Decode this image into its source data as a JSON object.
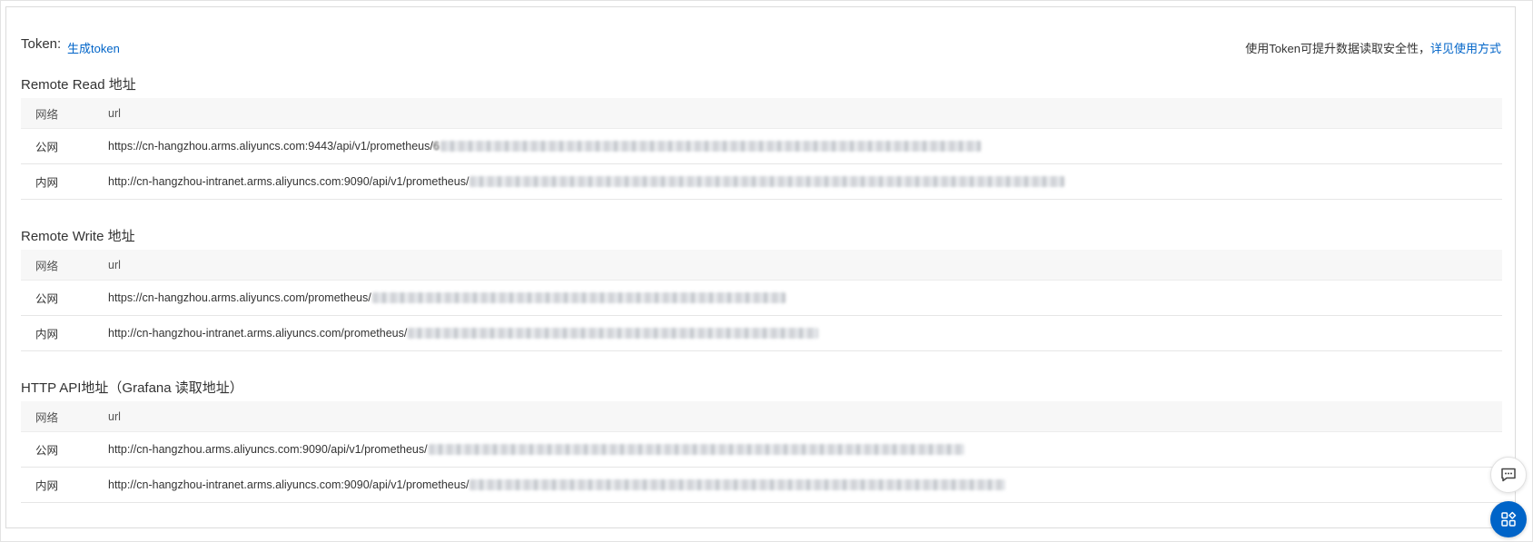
{
  "token": {
    "label": "Token:",
    "generate_link": "生成token",
    "hint_text": "使用Token可提升数据读取安全性，",
    "hint_link": "详见使用方式"
  },
  "headers": {
    "network": "网络",
    "url": "url"
  },
  "sections": [
    {
      "title": "Remote Read 地址",
      "rows": [
        {
          "network": "公网",
          "url": "https://cn-hangzhou.arms.aliyuncs.com:9443/api/v1/prometheus/",
          "redacted_tail": "6"
        },
        {
          "network": "内网",
          "url": "http://cn-hangzhou-intranet.arms.aliyuncs.com:9090/api/v1/prometheus/",
          "redacted_tail": ""
        }
      ]
    },
    {
      "title": "Remote Write 地址",
      "rows": [
        {
          "network": "公网",
          "url": "https://cn-hangzhou.arms.aliyuncs.com/prometheus/",
          "redacted_tail": ""
        },
        {
          "network": "内网",
          "url": "http://cn-hangzhou-intranet.arms.aliyuncs.com/prometheus/",
          "redacted_tail": ""
        }
      ]
    },
    {
      "title": "HTTP API地址（Grafana 读取地址）",
      "rows": [
        {
          "network": "公网",
          "url": "http://cn-hangzhou.arms.aliyuncs.com:9090/api/v1/prometheus/",
          "redacted_tail": ""
        },
        {
          "network": "内网",
          "url": "http://cn-hangzhou-intranet.arms.aliyuncs.com:9090/api/v1/prometheus/",
          "redacted_tail": ""
        }
      ]
    }
  ],
  "floating": {
    "chat_icon": "chat-bubble-icon",
    "apps_icon": "apps-grid-icon"
  },
  "colors": {
    "link": "#0064c8",
    "header_bg": "#f7f7f7",
    "fab_primary": "#0064c8"
  }
}
